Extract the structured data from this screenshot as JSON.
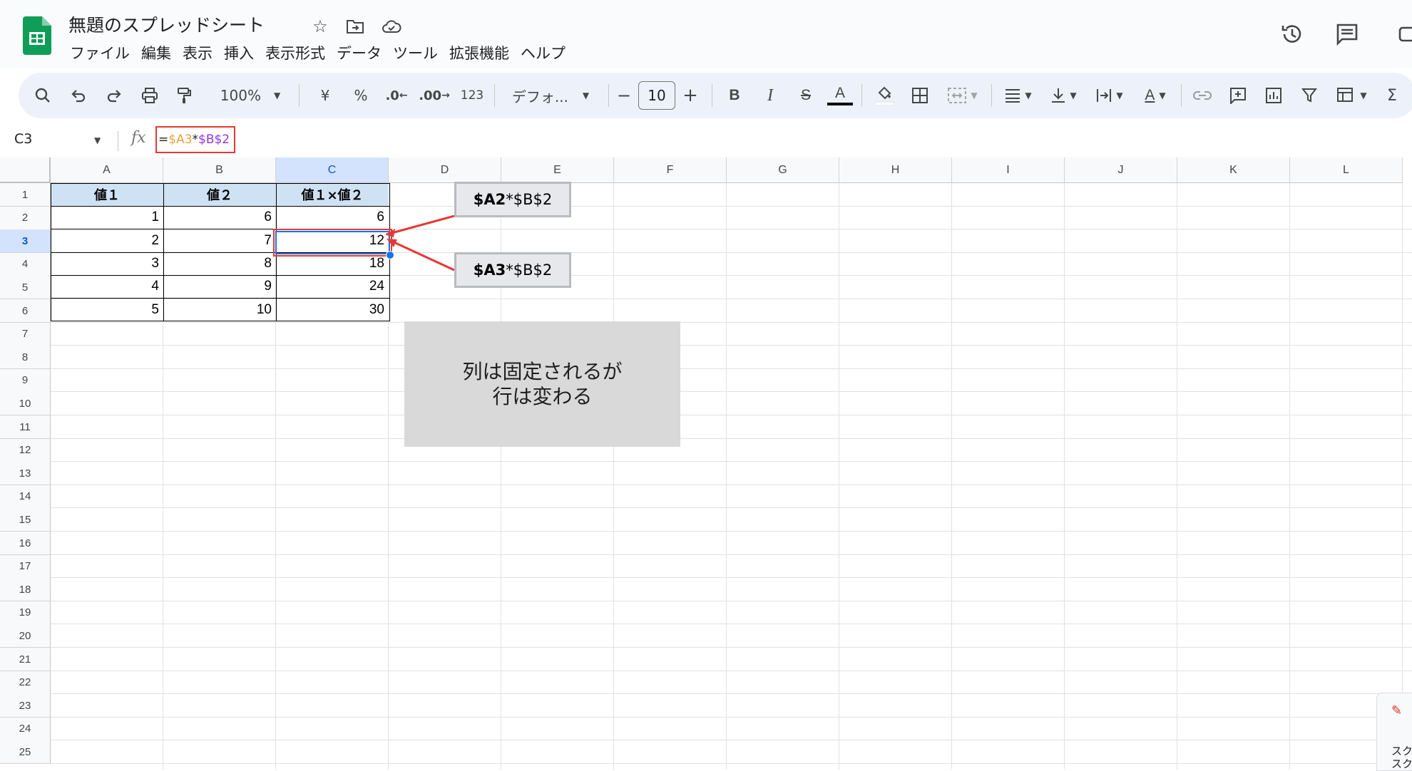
{
  "app": {
    "doc_title": "無題のスプレッドシート"
  },
  "menu": [
    "ファイル",
    "編集",
    "表示",
    "挿入",
    "表示形式",
    "データ",
    "ツール",
    "拡張機能",
    "ヘルプ"
  ],
  "toolbar": {
    "zoom": "100%",
    "currency": "¥",
    "percent": "%",
    "dec_decrease": ".0",
    "dec_increase": ".00",
    "number_format": "123",
    "font": "デフォ...",
    "font_size": "10",
    "minus": "−",
    "plus": "+",
    "bold": "B",
    "italic": "I",
    "strike": "S",
    "text_color": "A",
    "sum": "Σ",
    "text_rotate": "A"
  },
  "formula_bar": {
    "name_box": "C3",
    "fx": "fx",
    "formula_eq": "=",
    "formula_ref1": "$A3",
    "formula_op": "*",
    "formula_ref2": "$B$2"
  },
  "columns": [
    "A",
    "B",
    "C",
    "D",
    "E",
    "F",
    "G",
    "H",
    "I",
    "J",
    "K",
    "L"
  ],
  "rows": [
    "1",
    "2",
    "3",
    "4",
    "5",
    "6",
    "7",
    "8",
    "9",
    "10",
    "11",
    "12",
    "13",
    "14",
    "15",
    "16",
    "17",
    "18",
    "19",
    "20",
    "21",
    "22",
    "23",
    "24",
    "25"
  ],
  "active_cell": {
    "col": "C",
    "row": "3"
  },
  "table": {
    "headers": [
      "値１",
      "値２",
      "値１×値２"
    ],
    "rows": [
      [
        "1",
        "6",
        "6"
      ],
      [
        "2",
        "7",
        "12"
      ],
      [
        "3",
        "8",
        "18"
      ],
      [
        "4",
        "9",
        "24"
      ],
      [
        "5",
        "10",
        "30"
      ]
    ]
  },
  "callouts": [
    {
      "bold": "$A2",
      "rest": "*$B$2"
    },
    {
      "bold": "$A3",
      "rest": "*$B$2"
    }
  ],
  "note": {
    "line1": "列は固定されるが",
    "line2": "行は変わる"
  },
  "widget": {
    "line1": "スク",
    "line2": "スク"
  },
  "colors": {
    "accent_blue": "#1a73e8",
    "highlight_red": "#e53935",
    "header_fill": "#cfe2f3",
    "sheets_green": "#0f9d58"
  }
}
